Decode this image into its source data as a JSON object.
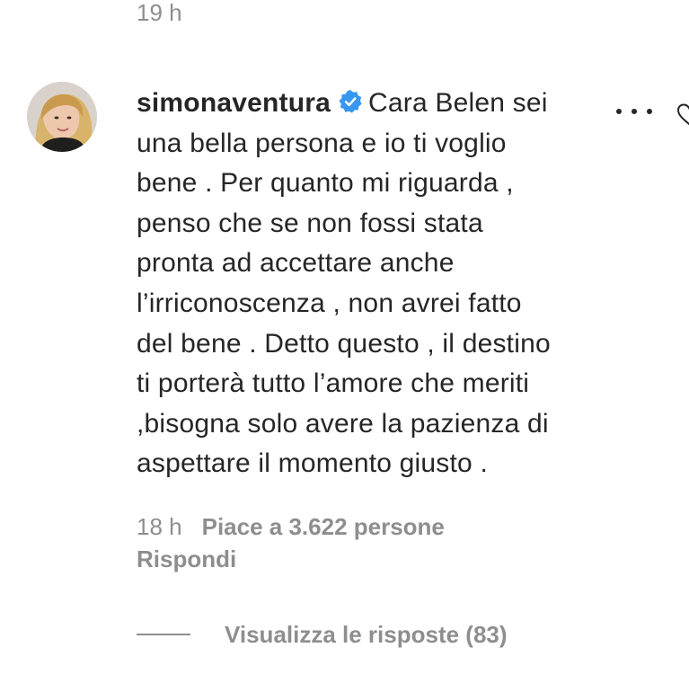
{
  "previous_comment": {
    "timestamp": "19 h"
  },
  "comment": {
    "username": "simonaventura",
    "verified_icon": "verified-badge-icon",
    "verified_color": "#3897f0",
    "text_lines": [
      "Cara Belen sei",
      "una bella persona e io ti voglio",
      "bene . Per quanto mi riguarda ,",
      "penso che se non fossi stata",
      "pronta ad accettare anche",
      "l’irriconoscenza , non avrei fatto",
      "del bene . Detto questo , il destino",
      "ti porterà tutto l’amore che meriti",
      ",bisogna solo avere la pazienza di",
      "aspettare il momento giusto ."
    ],
    "timestamp": "18 h",
    "likes": "Piace a 3.622 persone",
    "reply_label": "Rispondi",
    "view_replies_label": "Visualizza le risposte (83)"
  },
  "icons": {
    "more": "more-options-icon",
    "like": "heart-icon",
    "avatar": "avatar"
  },
  "colors": {
    "text": "#262626",
    "secondary": "#8e8e8e",
    "background": "#ffffff"
  }
}
